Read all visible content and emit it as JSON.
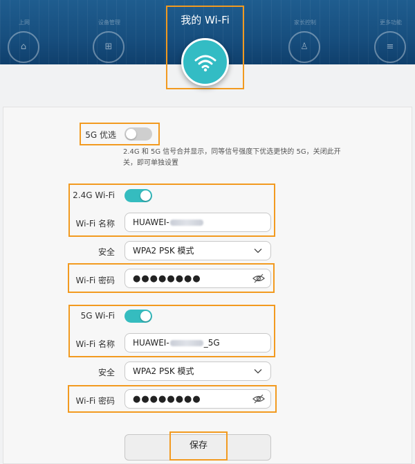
{
  "nav": {
    "items": [
      {
        "label": "上网",
        "glyph": "⌂"
      },
      {
        "label": "设备管理",
        "glyph": "⊞"
      },
      {
        "label": "家长控制",
        "glyph": "♙"
      },
      {
        "label": "更多功能",
        "glyph": "≡"
      }
    ],
    "active_title": "我的 Wi-Fi"
  },
  "colors": {
    "accent": "#35bcbf",
    "highlight": "#f29a1f",
    "banner": "#174e7e"
  },
  "settings": {
    "prefer_5g": {
      "label": "5G 优选",
      "state": "off"
    },
    "prefer_5g_note": "2.4G 和 5G 信号合并显示，同等信号强度下优选更快的 5G，关闭此开关，即可单独设置",
    "band_24": {
      "toggle_label": "2.4G Wi-Fi",
      "state": "on",
      "name_label": "Wi-Fi 名称",
      "name_prefix": "HUAWEI-",
      "name_suffix": "",
      "security_label": "安全",
      "security_value": "WPA2 PSK 模式",
      "password_label": "Wi-Fi 密码",
      "password_mask": "●●●●●●●●"
    },
    "band_5": {
      "toggle_label": "5G Wi-Fi",
      "state": "on",
      "name_label": "Wi-Fi 名称",
      "name_prefix": "HUAWEI-",
      "name_suffix": "_5G",
      "security_label": "安全",
      "security_value": "WPA2 PSK 模式",
      "password_label": "Wi-Fi 密码",
      "password_mask": "●●●●●●●●"
    }
  },
  "actions": {
    "save_label": "保存"
  },
  "icons": {
    "wifi": "wifi-icon",
    "eye_off": "eye-off-icon",
    "chevron": "chevron-down-icon"
  }
}
